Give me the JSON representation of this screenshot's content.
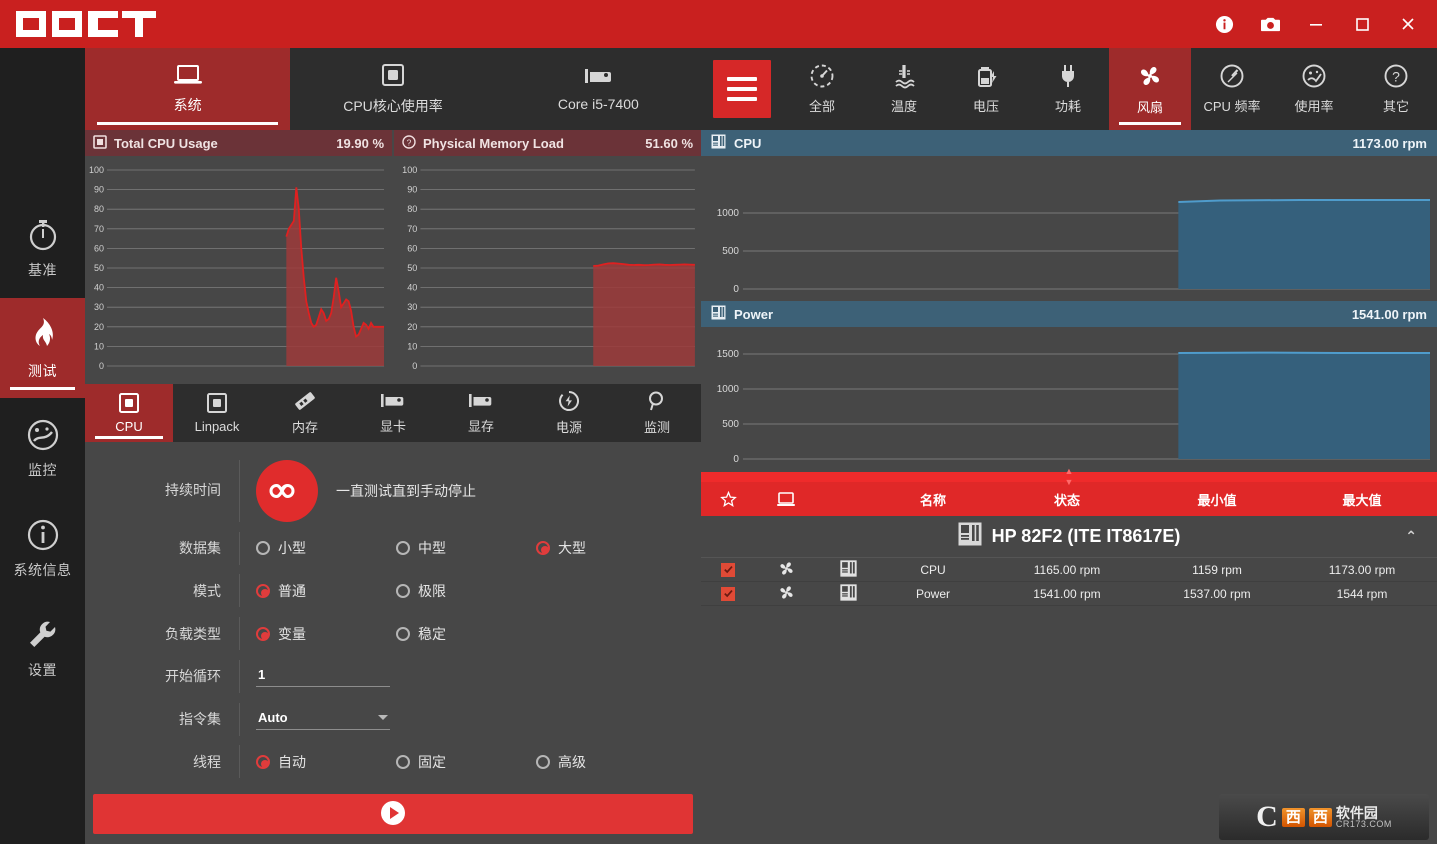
{
  "app": {
    "title": "OCCT",
    "titlebar_buttons": [
      {
        "name": "info-icon",
        "label": "i"
      },
      {
        "name": "screenshot-icon",
        "label": "camera"
      },
      {
        "name": "minimize-icon",
        "label": "minimize"
      },
      {
        "name": "maximize-icon",
        "label": "maximize"
      },
      {
        "name": "close-icon",
        "label": "close"
      }
    ]
  },
  "sidebar": {
    "items": [
      {
        "label": "基准",
        "icon": "stopwatch-icon",
        "active": false
      },
      {
        "label": "测试",
        "icon": "flame-icon",
        "active": true
      },
      {
        "label": "监控",
        "icon": "gauge-icon",
        "active": false
      },
      {
        "label": "系统信息",
        "icon": "info-circle-icon",
        "active": false
      },
      {
        "label": "设置",
        "icon": "wrench-icon",
        "active": false
      }
    ]
  },
  "system_tabs": [
    {
      "label": "系统",
      "icon": "laptop-icon",
      "active": true
    },
    {
      "label": "CPU核心使用率",
      "icon": "chip-icon",
      "active": false
    },
    {
      "label": "Core i5-7400",
      "icon": "gpu-icon",
      "active": false
    }
  ],
  "meters": [
    {
      "name": "Total CPU Usage",
      "value": "19.90 %",
      "icon": "chip-icon"
    },
    {
      "name": "Physical Memory Load",
      "value": "51.60 %",
      "icon": "question-icon"
    }
  ],
  "test_tabs": [
    {
      "label": "CPU",
      "icon": "cpu-icon",
      "active": true
    },
    {
      "label": "Linpack",
      "icon": "chip-icon",
      "active": false
    },
    {
      "label": "内存",
      "icon": "ram-icon",
      "active": false
    },
    {
      "label": "显卡",
      "icon": "gpu-icon",
      "active": false
    },
    {
      "label": "显存",
      "icon": "gpu-icon",
      "active": false
    },
    {
      "label": "电源",
      "icon": "power-icon",
      "active": false
    },
    {
      "label": "监测",
      "icon": "magnifier-icon",
      "active": false
    }
  ],
  "settings": {
    "duration_label": "持续时间",
    "duration_icon": "infinity-icon",
    "duration_text": "一直测试直到手动停止",
    "dataset_label": "数据集",
    "dataset_options": [
      {
        "label": "小型",
        "selected": false
      },
      {
        "label": "中型",
        "selected": false
      },
      {
        "label": "大型",
        "selected": true
      }
    ],
    "mode_label": "模式",
    "mode_options": [
      {
        "label": "普通",
        "selected": true
      },
      {
        "label": "极限",
        "selected": false
      }
    ],
    "load_type_label": "负载类型",
    "load_type_options": [
      {
        "label": "变量",
        "selected": true
      },
      {
        "label": "稳定",
        "selected": false
      }
    ],
    "start_cycle_label": "开始循环",
    "start_cycle_value": "1",
    "instruction_set_label": "指令集",
    "instruction_set_value": "Auto",
    "threads_label": "线程",
    "threads_options": [
      {
        "label": "自动",
        "selected": true
      },
      {
        "label": "固定",
        "selected": false
      },
      {
        "label": "高级",
        "selected": false
      }
    ],
    "run_button": "play-icon"
  },
  "sensor_tabs": [
    {
      "label": "全部",
      "icon": "all-sensors-icon",
      "active": false
    },
    {
      "label": "温度",
      "icon": "thermometer-icon",
      "active": false
    },
    {
      "label": "电压",
      "icon": "battery-icon",
      "active": false
    },
    {
      "label": "功耗",
      "icon": "plug-icon",
      "active": false
    },
    {
      "label": "风扇",
      "icon": "fan-icon",
      "active": true
    },
    {
      "label": "CPU 频率",
      "icon": "speedometer-icon",
      "active": false
    },
    {
      "label": "使用率",
      "icon": "usage-gauge-icon",
      "active": false
    },
    {
      "label": "其它",
      "icon": "question-circle-icon",
      "active": false
    }
  ],
  "graphs": [
    {
      "name": "CPU",
      "value": "1173.00 rpm",
      "icon": "motherboard-icon"
    },
    {
      "name": "Power",
      "value": "1541.00 rpm",
      "icon": "motherboard-icon"
    }
  ],
  "table": {
    "headers": [
      {
        "label": "",
        "icon": "star-icon"
      },
      {
        "label": "",
        "icon": "monitor-icon"
      },
      {
        "label": "",
        "icon": ""
      },
      {
        "label": "名称"
      },
      {
        "label": "状态"
      },
      {
        "label": "最小值"
      },
      {
        "label": "最大值"
      }
    ],
    "group": {
      "label": "HP 82F2 (ITE IT8617E)",
      "icon": "motherboard-icon",
      "chevron": "chevron-up-icon"
    },
    "rows": [
      {
        "checked": true,
        "type_icon": "fan-icon",
        "src_icon": "motherboard-icon",
        "name": "CPU",
        "status": "1165.00 rpm",
        "min": "1159 rpm",
        "max": "1173.00 rpm"
      },
      {
        "checked": true,
        "type_icon": "fan-icon",
        "src_icon": "motherboard-icon",
        "name": "Power",
        "status": "1541.00 rpm",
        "min": "1537.00 rpm",
        "max": "1544 rpm"
      }
    ]
  },
  "watermark": {
    "letter": "C",
    "box1": "西",
    "box2": "西",
    "line1": "软件园",
    "line2": "CR173.COM"
  },
  "colors": {
    "brand_red": "#c9201f",
    "accent_red": "#e02828",
    "active_tab_red": "#9e2b2b",
    "panel_bg": "#474747",
    "rail_bg": "#1f1f1f",
    "tab_bg": "#2d2d2d",
    "meter_head": "#6b3338",
    "graph_head_blue": "#3d6177",
    "graph_fill_blue": "#35607c",
    "graph_line_blue": "#4f9ccc"
  },
  "chart_data": [
    {
      "type": "area",
      "title": "Total CPU Usage",
      "ylabel": "%",
      "ylim": [
        0,
        100
      ],
      "yticks": [
        0,
        10,
        20,
        30,
        40,
        50,
        60,
        70,
        80,
        90,
        100
      ],
      "grid": true,
      "series": [
        {
          "name": "Total CPU Usage",
          "color": "#e02020",
          "x": [
            0,
            1,
            2,
            3,
            4,
            5,
            6,
            7,
            8,
            9,
            10,
            11,
            12,
            13,
            14,
            15,
            16,
            17,
            18,
            19,
            20,
            21,
            22,
            23,
            24,
            25,
            26,
            27,
            28,
            29,
            30,
            31,
            32,
            33,
            34,
            35,
            36
          ],
          "values": [
            66,
            70,
            72,
            74,
            91,
            82,
            60,
            45,
            33,
            27,
            22,
            20,
            21,
            25,
            29,
            27,
            23,
            24,
            27,
            35,
            45,
            38,
            30,
            32,
            34,
            33,
            28,
            20,
            15,
            16,
            19,
            22,
            21,
            19,
            22,
            20,
            19.9
          ]
        }
      ]
    },
    {
      "type": "area",
      "title": "Physical Memory Load",
      "ylabel": "%",
      "ylim": [
        0,
        100
      ],
      "yticks": [
        0,
        10,
        20,
        30,
        40,
        50,
        60,
        70,
        80,
        90,
        100
      ],
      "grid": true,
      "series": [
        {
          "name": "Physical Memory Load",
          "color": "#e02020",
          "x": [
            0,
            1,
            2,
            3,
            4,
            5,
            6,
            7,
            8,
            9,
            10,
            11,
            12,
            13,
            14,
            15,
            16,
            17,
            18,
            19,
            20,
            21,
            22,
            23,
            24
          ],
          "values": [
            51,
            51.2,
            51.8,
            52.3,
            52.4,
            52.2,
            51.9,
            51.6,
            51.5,
            51.6,
            51.4,
            51.5,
            51.7,
            51.8,
            51.6,
            51.5,
            51.6,
            51.7,
            51.8,
            51.7,
            51.6,
            51.7,
            51.8,
            51.7,
            51.6
          ]
        }
      ]
    },
    {
      "type": "area",
      "title": "CPU",
      "ylabel": "rpm",
      "ylim": [
        0,
        1300
      ],
      "yticks": [
        0,
        500,
        1000
      ],
      "grid": true,
      "series": [
        {
          "name": "CPU fan",
          "color": "#4f9ccc",
          "x": [
            0,
            1,
            2,
            3,
            4,
            5,
            6,
            7,
            8,
            9,
            10,
            11,
            12
          ],
          "values": [
            1159,
            1160,
            1165,
            1168,
            1170,
            1172,
            1173,
            1173,
            1172,
            1173,
            1173,
            1173,
            1173
          ]
        }
      ]
    },
    {
      "type": "area",
      "title": "Power",
      "ylabel": "rpm",
      "ylim": [
        0,
        1700
      ],
      "yticks": [
        0,
        500,
        1000,
        1500
      ],
      "grid": true,
      "series": [
        {
          "name": "Power fan",
          "color": "#4f9ccc",
          "x": [
            0,
            1,
            2,
            3,
            4,
            5,
            6,
            7,
            8,
            9,
            10,
            11,
            12
          ],
          "values": [
            1537,
            1539,
            1540,
            1541,
            1542,
            1544,
            1541,
            1541,
            1542,
            1541,
            1541,
            1541,
            1541
          ]
        }
      ]
    }
  ]
}
